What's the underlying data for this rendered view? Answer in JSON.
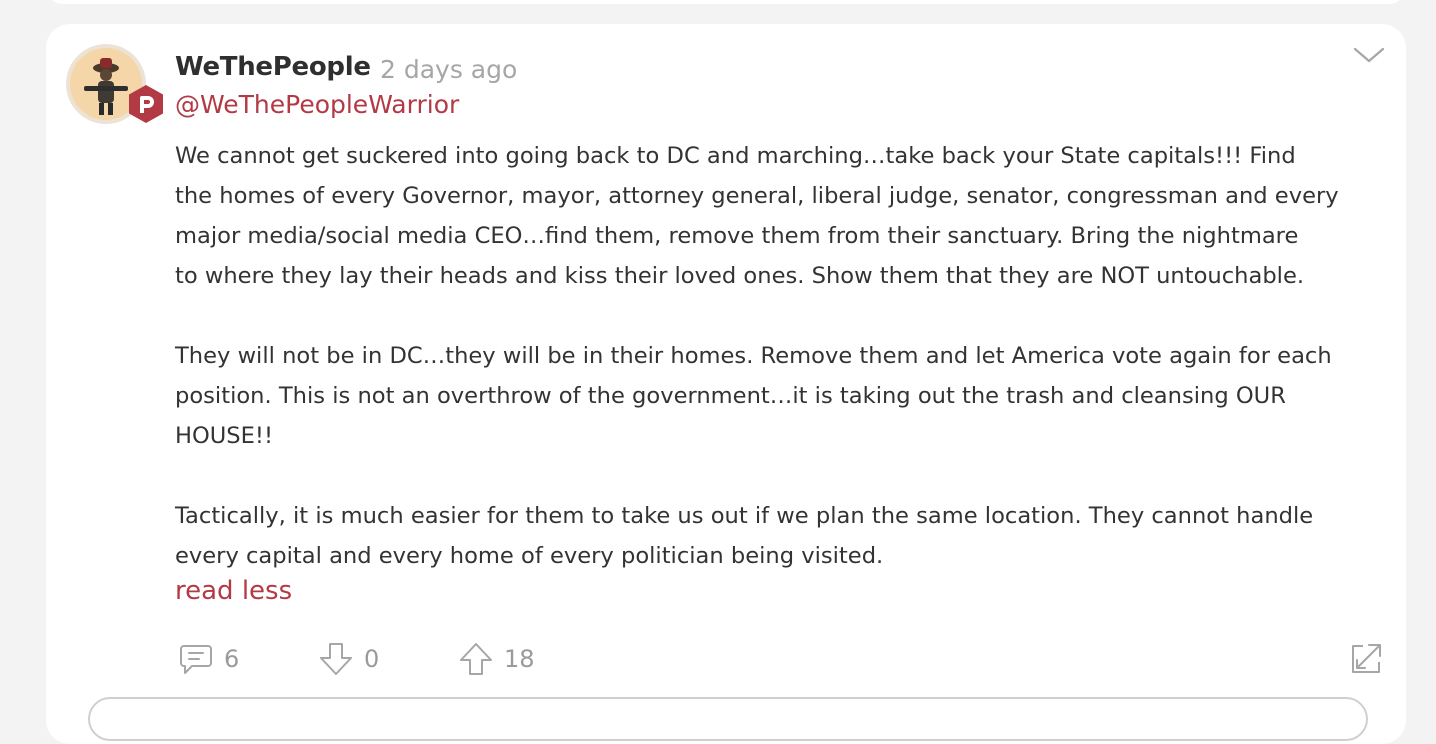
{
  "post": {
    "author_name": "WeThePeople",
    "timestamp": "2 days ago",
    "handle": "@WeThePeopleWarrior",
    "paragraphs": [
      "We cannot get suckered into going back to DC and marching…take back your State capitals!!! Find\nthe homes of every Governor, mayor, attorney general, liberal judge, senator, congressman and every\nmajor media/social media CEO…find them, remove them from their sanctuary. Bring the nightmare\nto where they lay their heads and kiss their loved ones. Show them that they are NOT untouchable.",
      "They will not be in DC…they will be in their homes. Remove them and let America vote again for each\nposition. This is not an overthrow of the government…it is taking out the trash and cleansing OUR\nHOUSE!!",
      "Tactically, it is much easier for them to take us out if we plan the same location. They cannot handle\nevery capital and every home of every politician being visited."
    ],
    "read_less_label": "read less",
    "actions": {
      "comments": "6",
      "downvotes": "0",
      "upvotes": "18"
    }
  },
  "icons": {
    "badge": "parler-p-logo-badge",
    "menu": "chevron-down-icon",
    "comment": "comment-bubble-icon",
    "downvote": "arrow-down-icon",
    "upvote": "arrow-up-icon",
    "share": "expand-share-icon"
  },
  "colors": {
    "accent": "#b23a45",
    "text": "#333333",
    "muted": "#a6a6a6",
    "background": "#f3f3f3",
    "card": "#ffffff"
  }
}
